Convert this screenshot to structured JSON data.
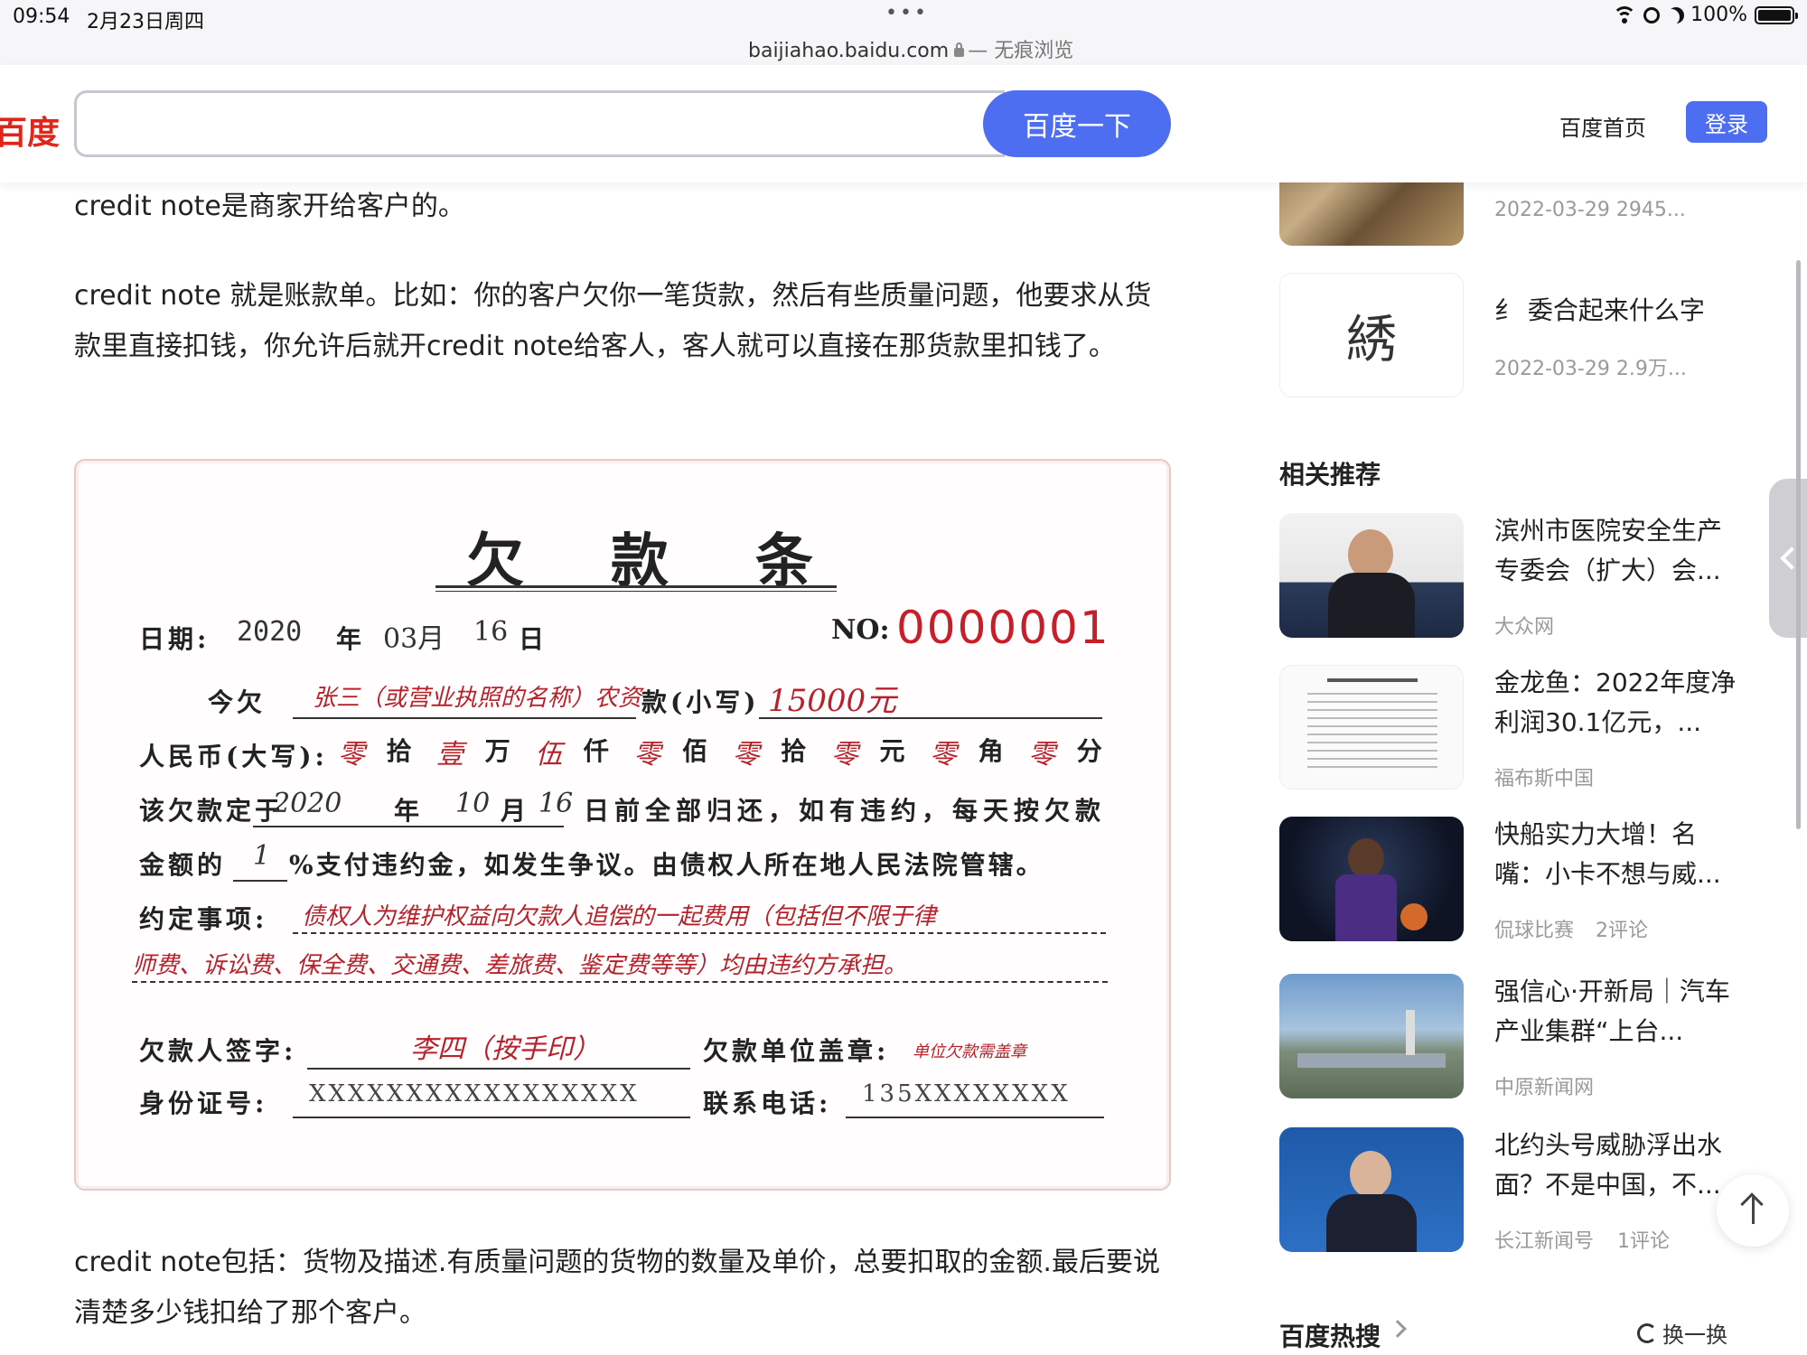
{
  "status": {
    "time": "09:54",
    "date": "2月23日周四",
    "url": "baijiahao.baidu.com",
    "private": "— 无痕浏览",
    "battery": "100%"
  },
  "header": {
    "logo": "百度",
    "search_value": "",
    "search_button": "百度一下",
    "home_link": "百度首页",
    "login": "登录"
  },
  "article": {
    "p1": "credit note是商家开给客户的。",
    "p2": "credit note 就是账款单。比如：你的客户欠你一笔货款，然后有些质量问题，他要求从货款里直接扣钱，你允许后就开credit note给客人，客人就可以直接在那货款里扣钱了。",
    "p3": "credit note包括：货物及描述.有质量问题的货物的数量及单价，总要扣取的金额.最后要说清楚多少钱扣给了那个客户。"
  },
  "receipt": {
    "title": "欠款条",
    "date_label": "日期:",
    "date_year": "2020",
    "year_char": "年",
    "date_month": "03月",
    "date_day": "16",
    "day_char": "日",
    "no_label": "NO:",
    "no_value": "0000001",
    "owe_label": "今欠",
    "owe_hand": "张三（或营业执照的名称）农资",
    "amount_label": "款(小写)",
    "amount_hand": "15000元",
    "rmb_label": "人民币(大写):",
    "rmb_hand": [
      "零",
      "壹",
      "伍",
      "零",
      "零",
      "零",
      "零",
      "零"
    ],
    "rmb_units": [
      "拾",
      "万",
      "仟",
      "佰",
      "拾",
      "元",
      "角",
      "分"
    ],
    "due_label": "该欠款定于",
    "due_year": "2020",
    "month_char": "月",
    "due_month": "10",
    "due_day": "16",
    "due_text": "日前全部归还，如有违约，每天按欠款",
    "rate_label": "金额的",
    "rate_hand": "1",
    "rate_text": "%支付违约金，如发生争议。由债权人所在地人民法院管辖。",
    "terms_label": "约定事项:",
    "terms_hand1": "债权人为维护权益向欠款人追偿的一起费用（包括但不限于律",
    "terms_hand2": "师费、诉讼费、保全费、交通费、差旅费、鉴定费等等）均由违约方承担。",
    "debtor_sign_label": "欠款人签字:",
    "debtor_sign_hand": "李四（按手印）",
    "seal_label": "欠款单位盖章:",
    "seal_hand": "单位欠款需盖章",
    "id_label": "身份证号:",
    "id_hand": "XXXXXXXXXXXXXXXXX",
    "phone_label": "联系电话:",
    "phone_hand": "135XXXXXXXX"
  },
  "sidebar": {
    "top_items": [
      {
        "meta": "2022-03-29   2945..."
      },
      {
        "char": "綉",
        "title": "纟 委合起来什么字",
        "meta": "2022-03-29   2.9万..."
      }
    ],
    "section_title": "相关推荐",
    "items": [
      {
        "title": "滨州市医院安全生产专委会（扩大）会...",
        "source": "大众网",
        "extra": ""
      },
      {
        "title": "金龙鱼：2022年度净利润30.1亿元，...",
        "source": "福布斯中国",
        "extra": ""
      },
      {
        "title": "快船实力大增！名嘴：小卡不想与威...",
        "source": "侃球比赛",
        "extra": "2评论"
      },
      {
        "title": "强信心·开新局｜汽车产业集群“上台...",
        "source": "中原新闻网",
        "extra": ""
      },
      {
        "title": "北约头号威胁浮出水面？不是中国，不...",
        "source": "长江新闻号",
        "extra": "1评论"
      }
    ],
    "hot_title": "百度热搜",
    "refresh": "换一换"
  },
  "colors": {
    "accent": "#4e6ef2",
    "logo_red": "#e1251b",
    "hand_red": "#b8202a"
  }
}
